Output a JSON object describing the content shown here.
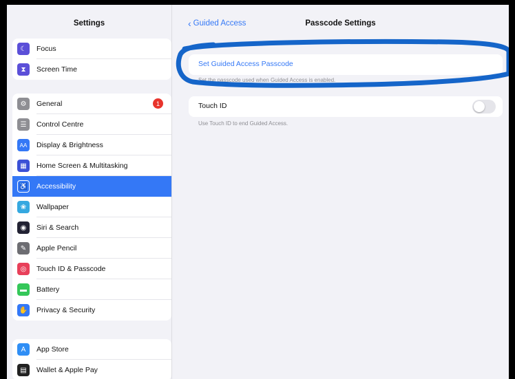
{
  "sidebar": {
    "title": "Settings",
    "group1": [
      {
        "label": "Focus",
        "icon": "moon-icon",
        "color": "#5b4fd8"
      },
      {
        "label": "Screen Time",
        "icon": "hourglass-icon",
        "color": "#5b4fd8"
      }
    ],
    "group2": [
      {
        "label": "General",
        "icon": "gear-icon",
        "color": "#8e8e93"
      },
      {
        "label": "Control Centre",
        "icon": "control-centre-icon",
        "color": "#8e8e93"
      },
      {
        "label": "Display & Brightness",
        "icon": "display-icon",
        "color": "#3478f6"
      },
      {
        "label": "Home Screen & Multitasking",
        "icon": "home-screen-icon",
        "color": "#3b50d6"
      },
      {
        "label": "Accessibility",
        "icon": "accessibility-icon",
        "color": "#3478f6"
      },
      {
        "label": "Wallpaper",
        "icon": "wallpaper-icon",
        "color": "#35a8e0"
      },
      {
        "label": "Siri & Search",
        "icon": "siri-icon",
        "color": "#222233"
      },
      {
        "label": "Apple Pencil",
        "icon": "pencil-icon",
        "color": "#6d6d72"
      },
      {
        "label": "Touch ID & Passcode",
        "icon": "fingerprint-icon",
        "color": "#e8405a"
      },
      {
        "label": "Battery",
        "icon": "battery-icon",
        "color": "#34c759"
      },
      {
        "label": "Privacy & Security",
        "icon": "hand-icon",
        "color": "#3478f6"
      }
    ],
    "general_badge": "1",
    "active_item": "Accessibility",
    "group3": [
      {
        "label": "App Store",
        "icon": "app-store-icon",
        "color": "#2f8ef5"
      },
      {
        "label": "Wallet & Apple Pay",
        "icon": "wallet-icon",
        "color": "#222222"
      }
    ]
  },
  "detail": {
    "back_label": "Guided Access",
    "title": "Passcode Settings",
    "set_passcode_label": "Set Guided Access Passcode",
    "passcode_footer": "Set the passcode used when Guided Access is enabled.",
    "touch_id_label": "Touch ID",
    "touch_id_enabled": false,
    "touch_id_footer": "Use Touch ID to end Guided Access."
  },
  "colors": {
    "accent": "#3478f6",
    "annotation": "#1565c9"
  }
}
